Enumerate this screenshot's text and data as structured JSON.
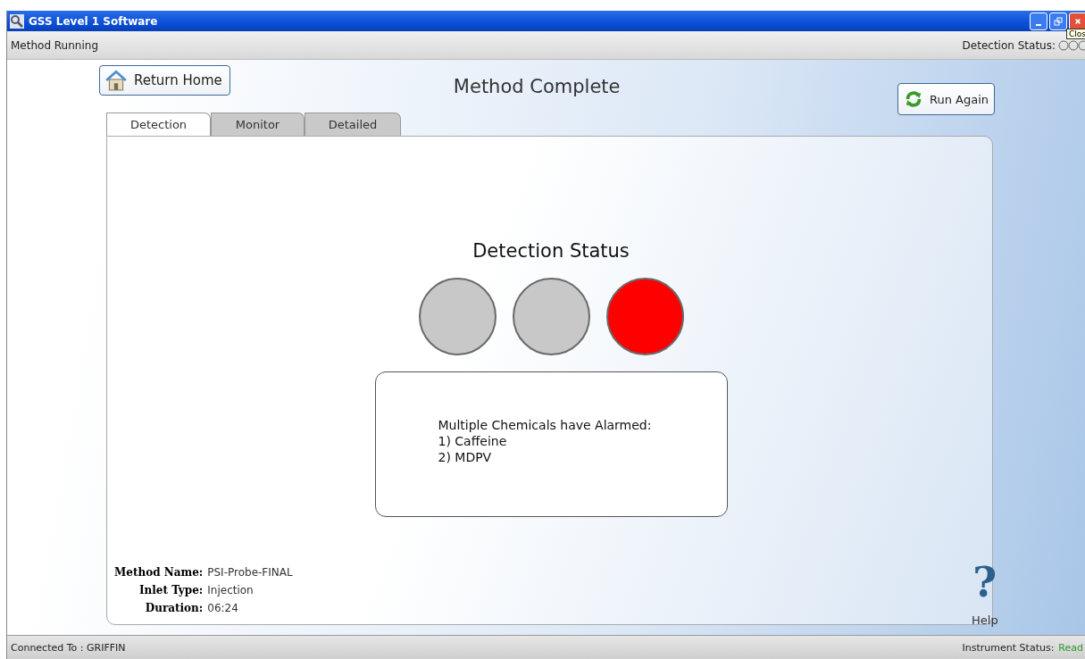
{
  "window": {
    "title": "GSS Level 1 Software",
    "tooltip": "Clos"
  },
  "header": {
    "mode": "Method Running",
    "detection_label": "Detection Status:"
  },
  "toolbar": {
    "return_button": "Return Home",
    "heading": "Method Complete",
    "run_button": "Run Again"
  },
  "tabs": [
    {
      "label": "Detection",
      "selected": true
    },
    {
      "label": "Monitor",
      "selected": false
    },
    {
      "label": "Detailed",
      "selected": false
    }
  ],
  "detection": {
    "title": "Detection Status",
    "lights": [
      {
        "color": "#c8c8c8"
      },
      {
        "color": "#c8c8c8"
      },
      {
        "color": "#ff0000"
      }
    ],
    "message": [
      "Multiple Chemicals have Alarmed:",
      "1) Caffeine",
      "2) MDPV"
    ]
  },
  "info": [
    {
      "label": "Method Name:",
      "value": "PSI-Probe-FINAL"
    },
    {
      "label": "Inlet Type:",
      "value": "Injection"
    },
    {
      "label": "Duration:",
      "value": "06:24"
    }
  ],
  "help": {
    "icon": "?",
    "label": "Help"
  },
  "status_bar": {
    "connection": "Connected To : GRIFFIN",
    "instrument_label": "Instrument Status:",
    "instrument_value": "Read"
  }
}
